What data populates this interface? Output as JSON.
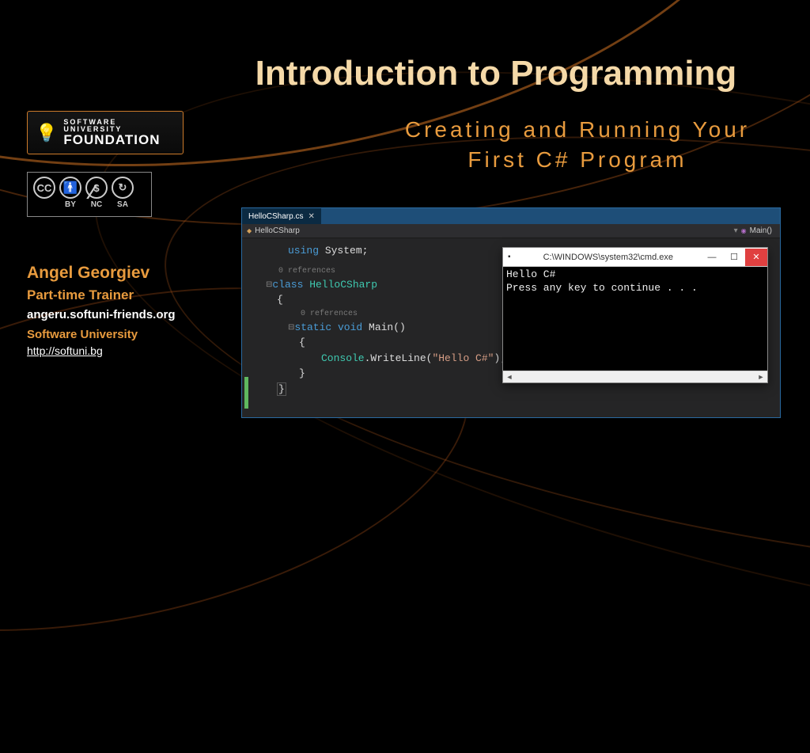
{
  "title": "Introduction to Programming",
  "subtitle": "Creating and Running Your First C# Program",
  "logo": {
    "top": "SOFTWARE UNIVERSITY",
    "bottom": "FOUNDATION"
  },
  "cc": {
    "labels": [
      "",
      "BY",
      "NC",
      "SA"
    ],
    "badges": [
      "CC",
      "👤",
      "$⃠",
      "⟲"
    ]
  },
  "author": {
    "name": "Angel Georgiev",
    "role": "Part-time Trainer",
    "site": "angeru.softuni-friends.org",
    "org": "Software University",
    "org_url": "http://softuni.bg"
  },
  "editor": {
    "tab": "HelloCSharp.cs",
    "nav_left": "HelloCSharp",
    "nav_right": "Main()",
    "refs": "0 references",
    "code": {
      "l1a": "using",
      "l1b": " System;",
      "l2a": "class",
      "l2b": " HelloCSharp",
      "l3": "{",
      "l4a": "static",
      "l4b": " void",
      "l4c": " Main()",
      "l5": "{",
      "l6a": "Console",
      "l6b": ".WriteLine(",
      "l6c": "\"Hello C#\"",
      "l6d": ");",
      "l7": "}",
      "l8": "}"
    }
  },
  "console": {
    "title": "C:\\WINDOWS\\system32\\cmd.exe",
    "output": "Hello C#\nPress any key to continue . . ."
  }
}
